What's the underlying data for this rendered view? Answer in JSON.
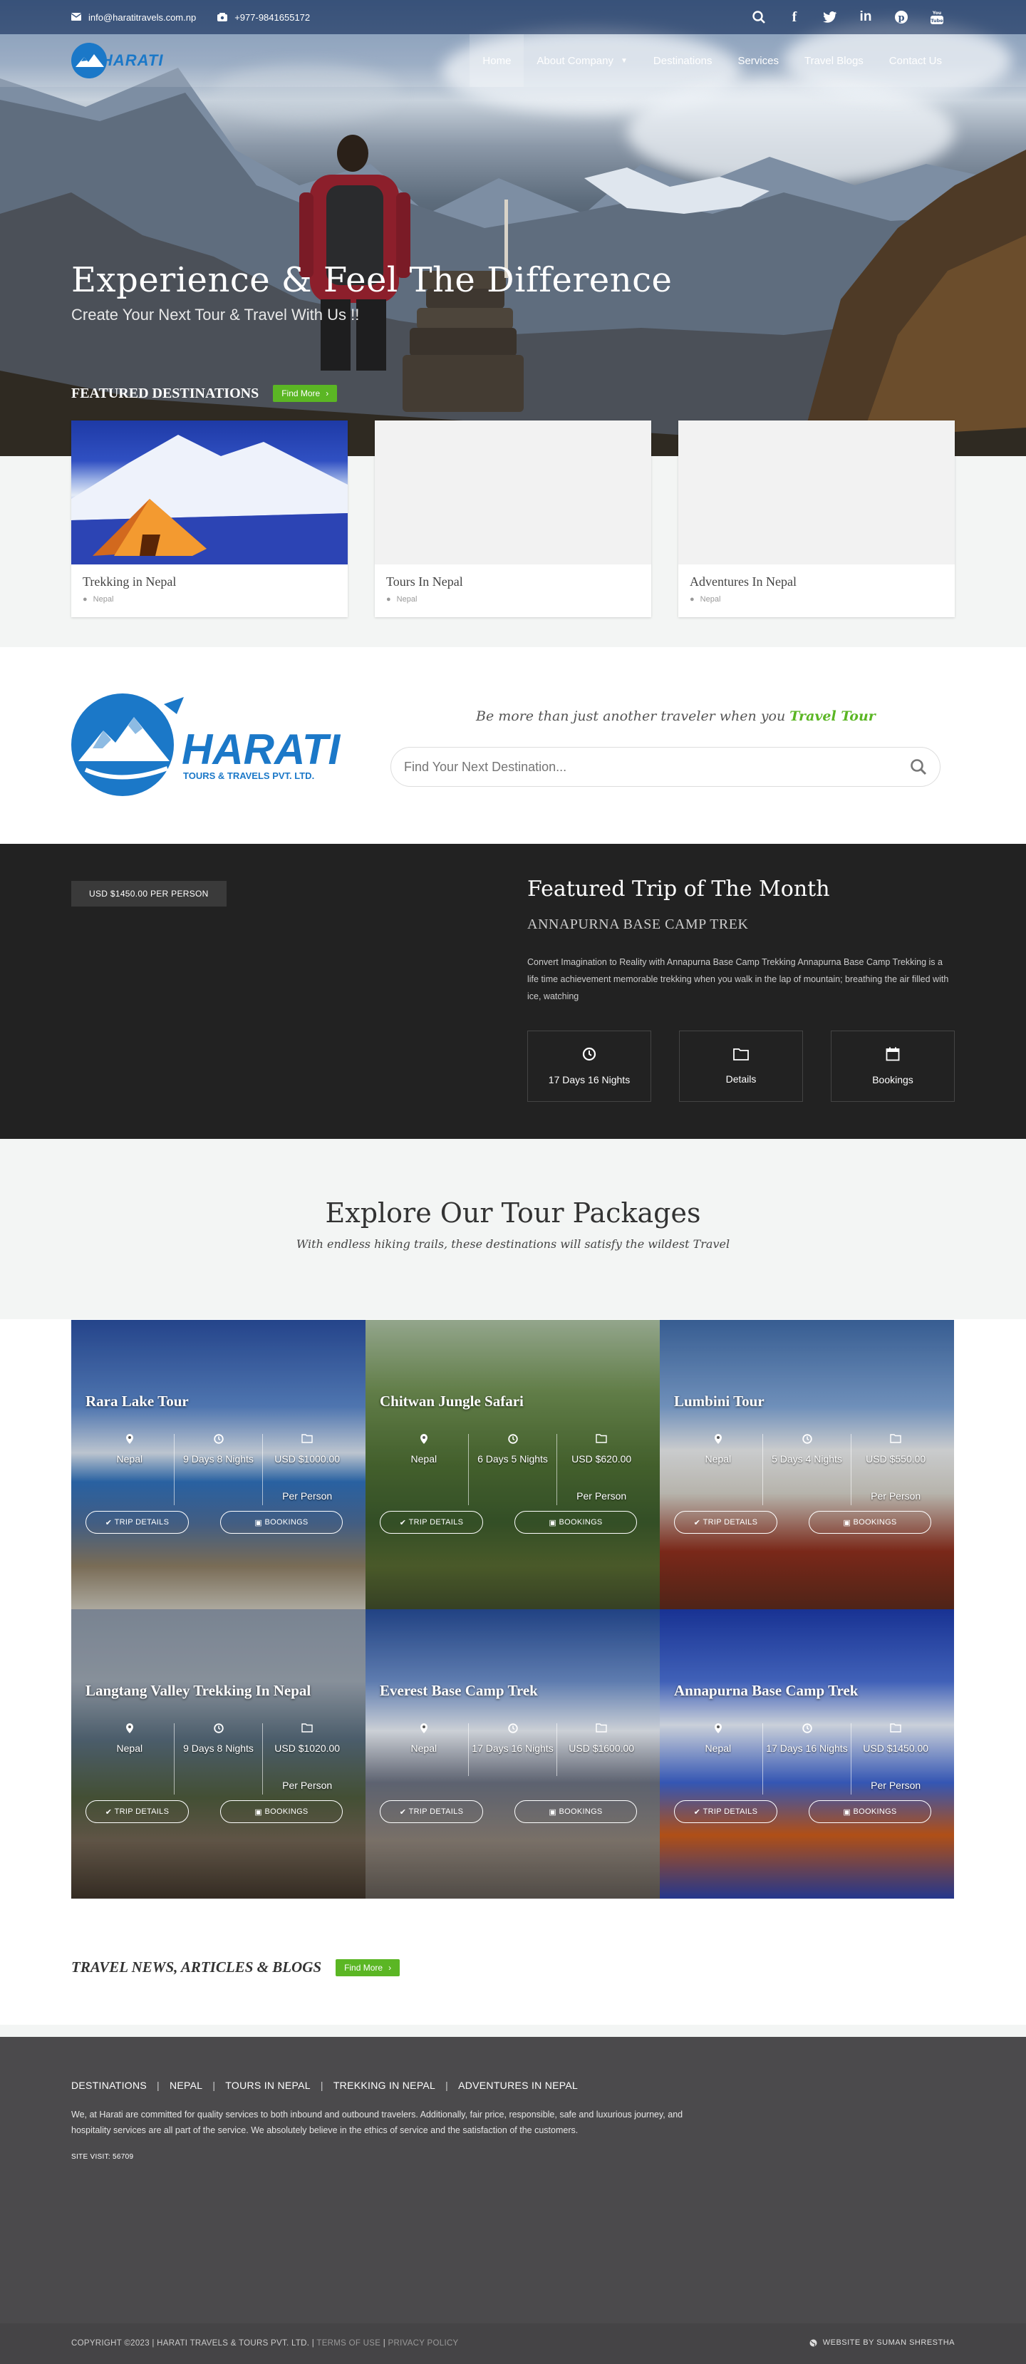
{
  "topbar": {
    "email": "info@haratitravels.com.np",
    "phone": "+977-9841655172"
  },
  "brand": {
    "logo_text": "HARATI",
    "logo_subtitle": "TOURS & TRAVELS PVT. LTD."
  },
  "nav": {
    "items": [
      {
        "label": "Home"
      },
      {
        "label": "About Company"
      },
      {
        "label": "Destinations"
      },
      {
        "label": "Services"
      },
      {
        "label": "Travel Blogs"
      },
      {
        "label": "Contact Us"
      }
    ]
  },
  "hero": {
    "title": "Experience & Feel The Difference",
    "subtitle": "Create Your Next Tour & Travel With Us !!"
  },
  "featured": {
    "heading": "FEATURED DESTINATIONS",
    "button": "Find More",
    "cards": [
      {
        "title": "Trekking in Nepal",
        "location": "Nepal"
      },
      {
        "title": "Tours In Nepal",
        "location": "Nepal"
      },
      {
        "title": "Adventures In Nepal",
        "location": "Nepal"
      }
    ]
  },
  "search": {
    "tagline": "Be more than just another traveler when you",
    "tagline_highlight": "Travel Tour",
    "placeholder": "Find Your Next Destination..."
  },
  "trip": {
    "price": "USD $1450.00 PER PERSON",
    "title": "Featured Trip of The Month",
    "name": "ANNAPURNA BASE CAMP TREK",
    "description": "Convert Imagination to Reality with Annapurna Base Camp Trekking Annapurna Base Camp Trekking is a life time achievement memorable trekking when you walk in the lap of mountain; breathing the air filled with ice, watching",
    "buttons": [
      "17 Days 16 Nights",
      "Details",
      "Bookings"
    ]
  },
  "packages": {
    "title": "Explore Our Tour Packages",
    "subtitle": "With endless hiking trails, these destinations will satisfy the wildest Travel",
    "trip_details_label": "TRIP DETAILS",
    "bookings_label": "BOOKINGS",
    "items": [
      {
        "title": "Rara Lake Tour",
        "location": "Nepal",
        "duration": "9 Days 8 Nights",
        "price": "USD $1000.00",
        "per": "Per Person"
      },
      {
        "title": "Chitwan Jungle Safari",
        "location": "Nepal",
        "duration": "6 Days 5 Nights",
        "price": "USD $620.00",
        "per": "Per Person"
      },
      {
        "title": "Lumbini Tour",
        "location": "Nepal",
        "duration": "5 Days 4 Nights",
        "price": "USD $550.00",
        "per": "Per Person"
      },
      {
        "title": "Langtang Valley Trekking In Nepal",
        "location": "Nepal",
        "duration": "9 Days 8 Nights",
        "price": "USD $1020.00",
        "per": "Per Person"
      },
      {
        "title": "Everest Base Camp Trek",
        "location": "Nepal",
        "duration": "17 Days 16 Nights",
        "price": "USD $1600.00",
        "per": ""
      },
      {
        "title": "Annapurna Base Camp Trek",
        "location": "Nepal",
        "duration": "17 Days 16 Nights",
        "price": "USD $1450.00",
        "per": "Per Person"
      }
    ]
  },
  "blog": {
    "heading": "TRAVEL NEWS, ARTICLES & BLOGS",
    "button": "Find More"
  },
  "footer": {
    "links": [
      "DESTINATIONS",
      "NEPAL",
      "TOURS IN NEPAL",
      "TREKKING IN NEPAL",
      "ADVENTURES IN NEPAL"
    ],
    "description": "We, at Harati are committed for quality services to both inbound and outbound travelers. Additionally, fair price, responsible, safe and luxurious journey, and hospitality services are all part of the service. We absolutely believe in the ethics of service and the satisfaction of the customers.",
    "site_visit": "SITE VISIT: 56709",
    "copyright": "COPYRIGHT ©2023 | HARATI TRAVELS & TOURS PVT. LTD. |",
    "terms": "TERMS OF USE",
    "privacy": "PRIVACY POLICY",
    "credit": "WEBSITE BY SUMAN SHRESTHA"
  },
  "colors": {
    "accent_green": "#5bb624",
    "brand_blue": "#1b78c8",
    "dark_band": "#222222",
    "footer": "#4b4a4c"
  }
}
